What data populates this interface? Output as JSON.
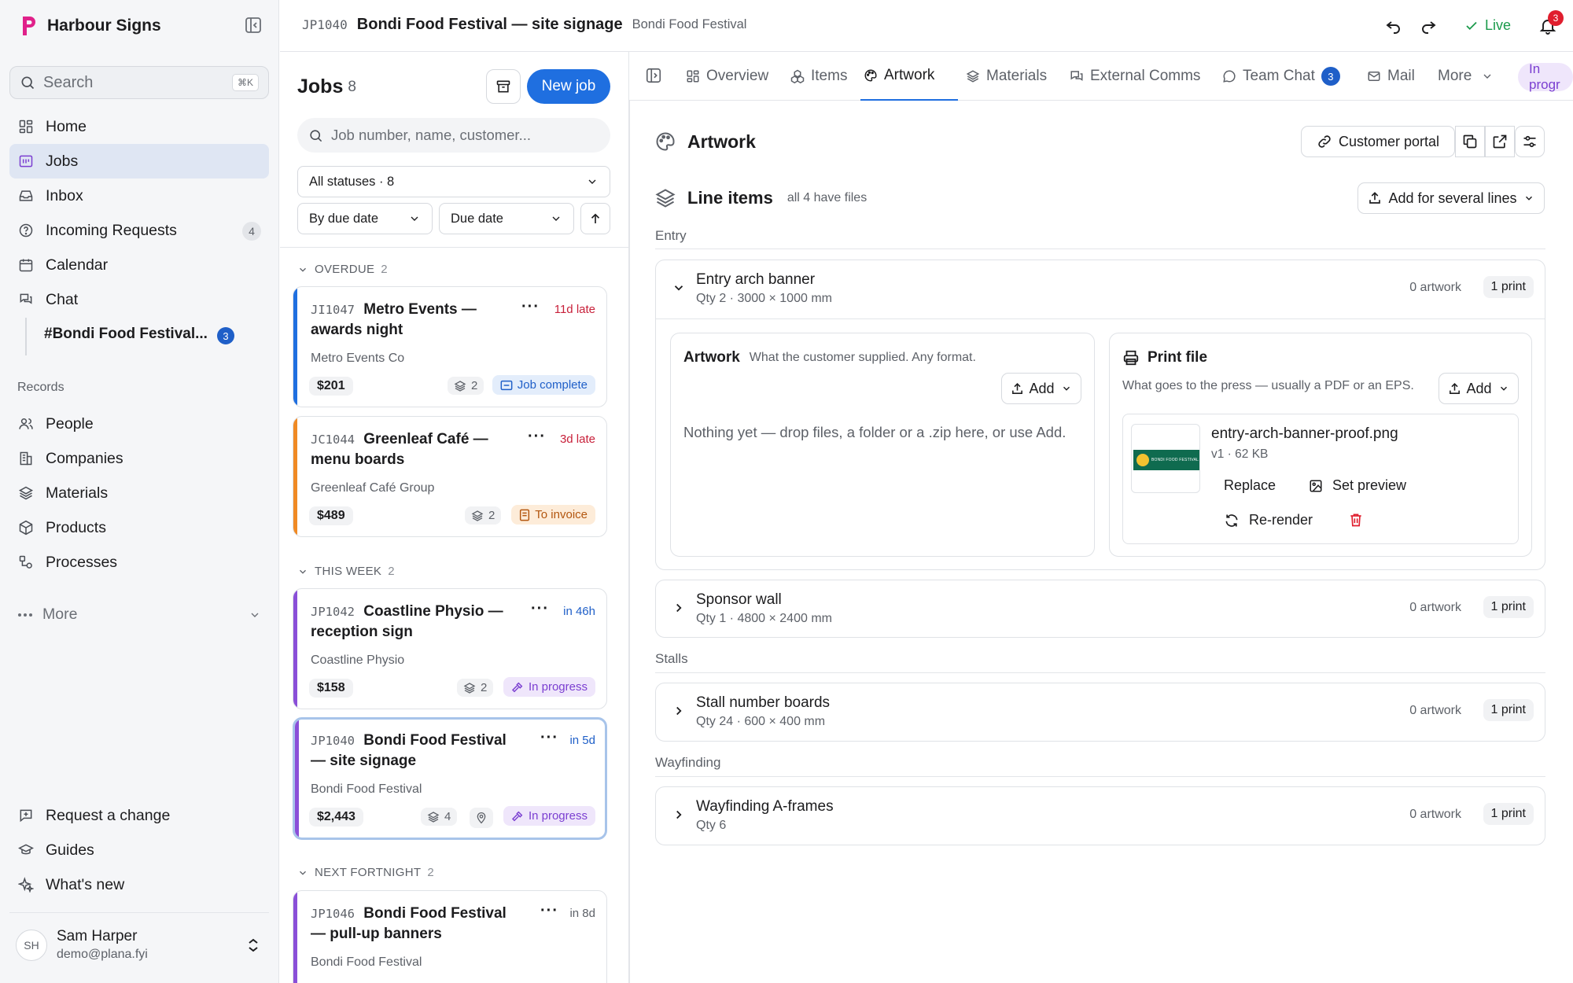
{
  "app": {
    "name": "Harbour Signs"
  },
  "sidebar": {
    "search_placeholder": "Search",
    "search_shortcut": "⌘K",
    "nav": [
      {
        "label": "Home",
        "icon": "home-icon"
      },
      {
        "label": "Jobs",
        "icon": "jobs-icon",
        "active": true
      },
      {
        "label": "Inbox",
        "icon": "inbox-icon"
      },
      {
        "label": "Incoming Requests",
        "icon": "question-icon",
        "badge": "4"
      },
      {
        "label": "Calendar",
        "icon": "calendar-icon"
      },
      {
        "label": "Chat",
        "icon": "chat-icon"
      }
    ],
    "channel": {
      "label": "#Bondi Food Festival...",
      "badge": "3"
    },
    "records_label": "Records",
    "records": [
      {
        "label": "People",
        "icon": "people-icon"
      },
      {
        "label": "Companies",
        "icon": "companies-icon"
      },
      {
        "label": "Materials",
        "icon": "layers-icon"
      },
      {
        "label": "Products",
        "icon": "box-icon"
      },
      {
        "label": "Processes",
        "icon": "processes-icon"
      }
    ],
    "more_label": "More",
    "footer": [
      {
        "label": "Request a change",
        "icon": "request-change-icon"
      },
      {
        "label": "Guides",
        "icon": "guides-icon"
      },
      {
        "label": "What's new",
        "icon": "sparkle-icon"
      }
    ],
    "user": {
      "initials": "SH",
      "name": "Sam Harper",
      "email": "demo@plana.fyi"
    }
  },
  "header": {
    "job_code": "JP1040",
    "job_title": "Bondi Food Festival — site signage",
    "customer": "Bondi Food Festival",
    "live_label": "Live",
    "notifications": "3"
  },
  "jobs": {
    "title": "Jobs",
    "count": "8",
    "new_job_label": "New job",
    "search_placeholder": "Job number, name, customer...",
    "status_filter": "All statuses · 8",
    "sort_by": "By due date",
    "sort_field": "Due date",
    "groups": [
      {
        "label": "OVERDUE",
        "count": "2"
      },
      {
        "label": "THIS WEEK",
        "count": "2"
      },
      {
        "label": "NEXT FORTNIGHT",
        "count": "2"
      }
    ],
    "cards": [
      {
        "code": "JI1047",
        "title1": "Metro Events —",
        "title2": "awards night",
        "customer": "Metro Events Co",
        "due": "11d late",
        "price": "$201",
        "count": "2",
        "status": "Job complete"
      },
      {
        "code": "JC1044",
        "title1": "Greenleaf Café —",
        "title2": "menu boards",
        "customer": "Greenleaf Café Group",
        "due": "3d late",
        "price": "$489",
        "count": "2",
        "status": "To invoice"
      },
      {
        "code": "JP1042",
        "title1": "Coastline Physio —",
        "title2": "reception sign",
        "customer": "Coastline Physio",
        "due": "in 46h",
        "price": "$158",
        "count": "2",
        "status": "In progress"
      },
      {
        "code": "JP1040",
        "title1": "Bondi Food Festival",
        "title2": "— site signage",
        "customer": "Bondi Food Festival",
        "due": "in 5d",
        "price": "$2,443",
        "count": "4",
        "status": "In progress"
      },
      {
        "code": "JP1046",
        "title1": "Bondi Food Festival",
        "title2": "— pull-up banners",
        "customer": "Bondi Food Festival",
        "due": "in 8d"
      }
    ]
  },
  "tabs": [
    {
      "label": "Overview",
      "icon": "overview-icon"
    },
    {
      "label": "Items",
      "icon": "items-icon"
    },
    {
      "label": "Artwork",
      "icon": "palette-icon",
      "active": true
    },
    {
      "label": "Materials",
      "icon": "layers-icon"
    },
    {
      "label": "External Comms",
      "icon": "comms-icon"
    },
    {
      "label": "Team Chat",
      "icon": "chat-bubble-icon",
      "badge": "3"
    },
    {
      "label": "Mail",
      "icon": "mail-icon"
    },
    {
      "label": "More",
      "icon": "chevron-down-icon"
    }
  ],
  "status_pill": "In progr",
  "artwork": {
    "title": "Artwork",
    "portal_label": "Customer portal",
    "line_items_title": "Line items",
    "line_items_note": "all 4 have files",
    "add_several_label": "Add for several lines",
    "groups": [
      "Entry",
      "Stalls",
      "Wayfinding"
    ],
    "items": [
      {
        "title": "Entry arch banner",
        "sub": "Qty 2 · 3000 × 1000 mm",
        "artwork": "0 artwork",
        "print": "1 print"
      },
      {
        "title": "Sponsor wall",
        "sub": "Qty 1 · 4800 × 2400 mm",
        "artwork": "0 artwork",
        "print": "1 print"
      },
      {
        "title": "Stall number boards",
        "sub": "Qty 24 · 600 × 400 mm",
        "artwork": "0 artwork",
        "print": "1 print"
      },
      {
        "title": "Wayfinding A-frames",
        "sub": "Qty 6",
        "artwork": "0 artwork",
        "print": "1 print"
      }
    ],
    "artwork_panel": {
      "title": "Artwork",
      "note": "What the customer supplied. Any format.",
      "add_label": "Add",
      "empty": "Nothing yet — drop files, a folder or a .zip here, or use Add."
    },
    "print_panel": {
      "title": "Print file",
      "note": "What goes to the press — usually a PDF or an EPS.",
      "add_label": "Add",
      "file": {
        "name": "entry-arch-banner-proof.png",
        "meta": "v1 · 62 KB",
        "thumb_text": "BONDI FOOD FESTIVAL",
        "replace_label": "Replace",
        "set_preview_label": "Set preview",
        "rerender_label": "Re-render"
      }
    }
  }
}
